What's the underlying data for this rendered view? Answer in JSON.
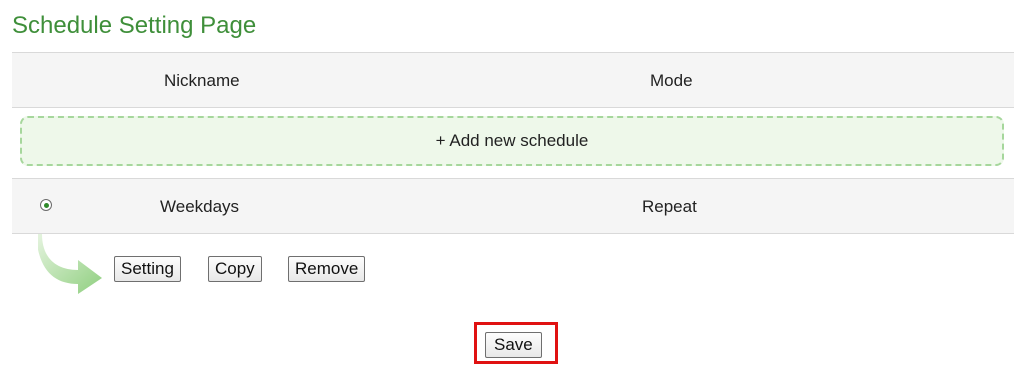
{
  "page": {
    "title": "Schedule Setting Page"
  },
  "table": {
    "columns": [
      "Nickname",
      "Mode"
    ],
    "add_label": "+ Add new schedule",
    "rows": [
      {
        "nickname": "Weekdays",
        "mode": "Repeat",
        "selected": true
      }
    ]
  },
  "actions": {
    "setting_label": "Setting",
    "copy_label": "Copy",
    "remove_label": "Remove"
  },
  "footer": {
    "save_label": "Save"
  },
  "colors": {
    "title_green": "#3f8f3a",
    "dashed_border": "#a6d79c",
    "highlight_red": "#e01111"
  },
  "icons": {
    "selection": "radio-selected-icon",
    "arrow": "curved-arrow-icon"
  }
}
